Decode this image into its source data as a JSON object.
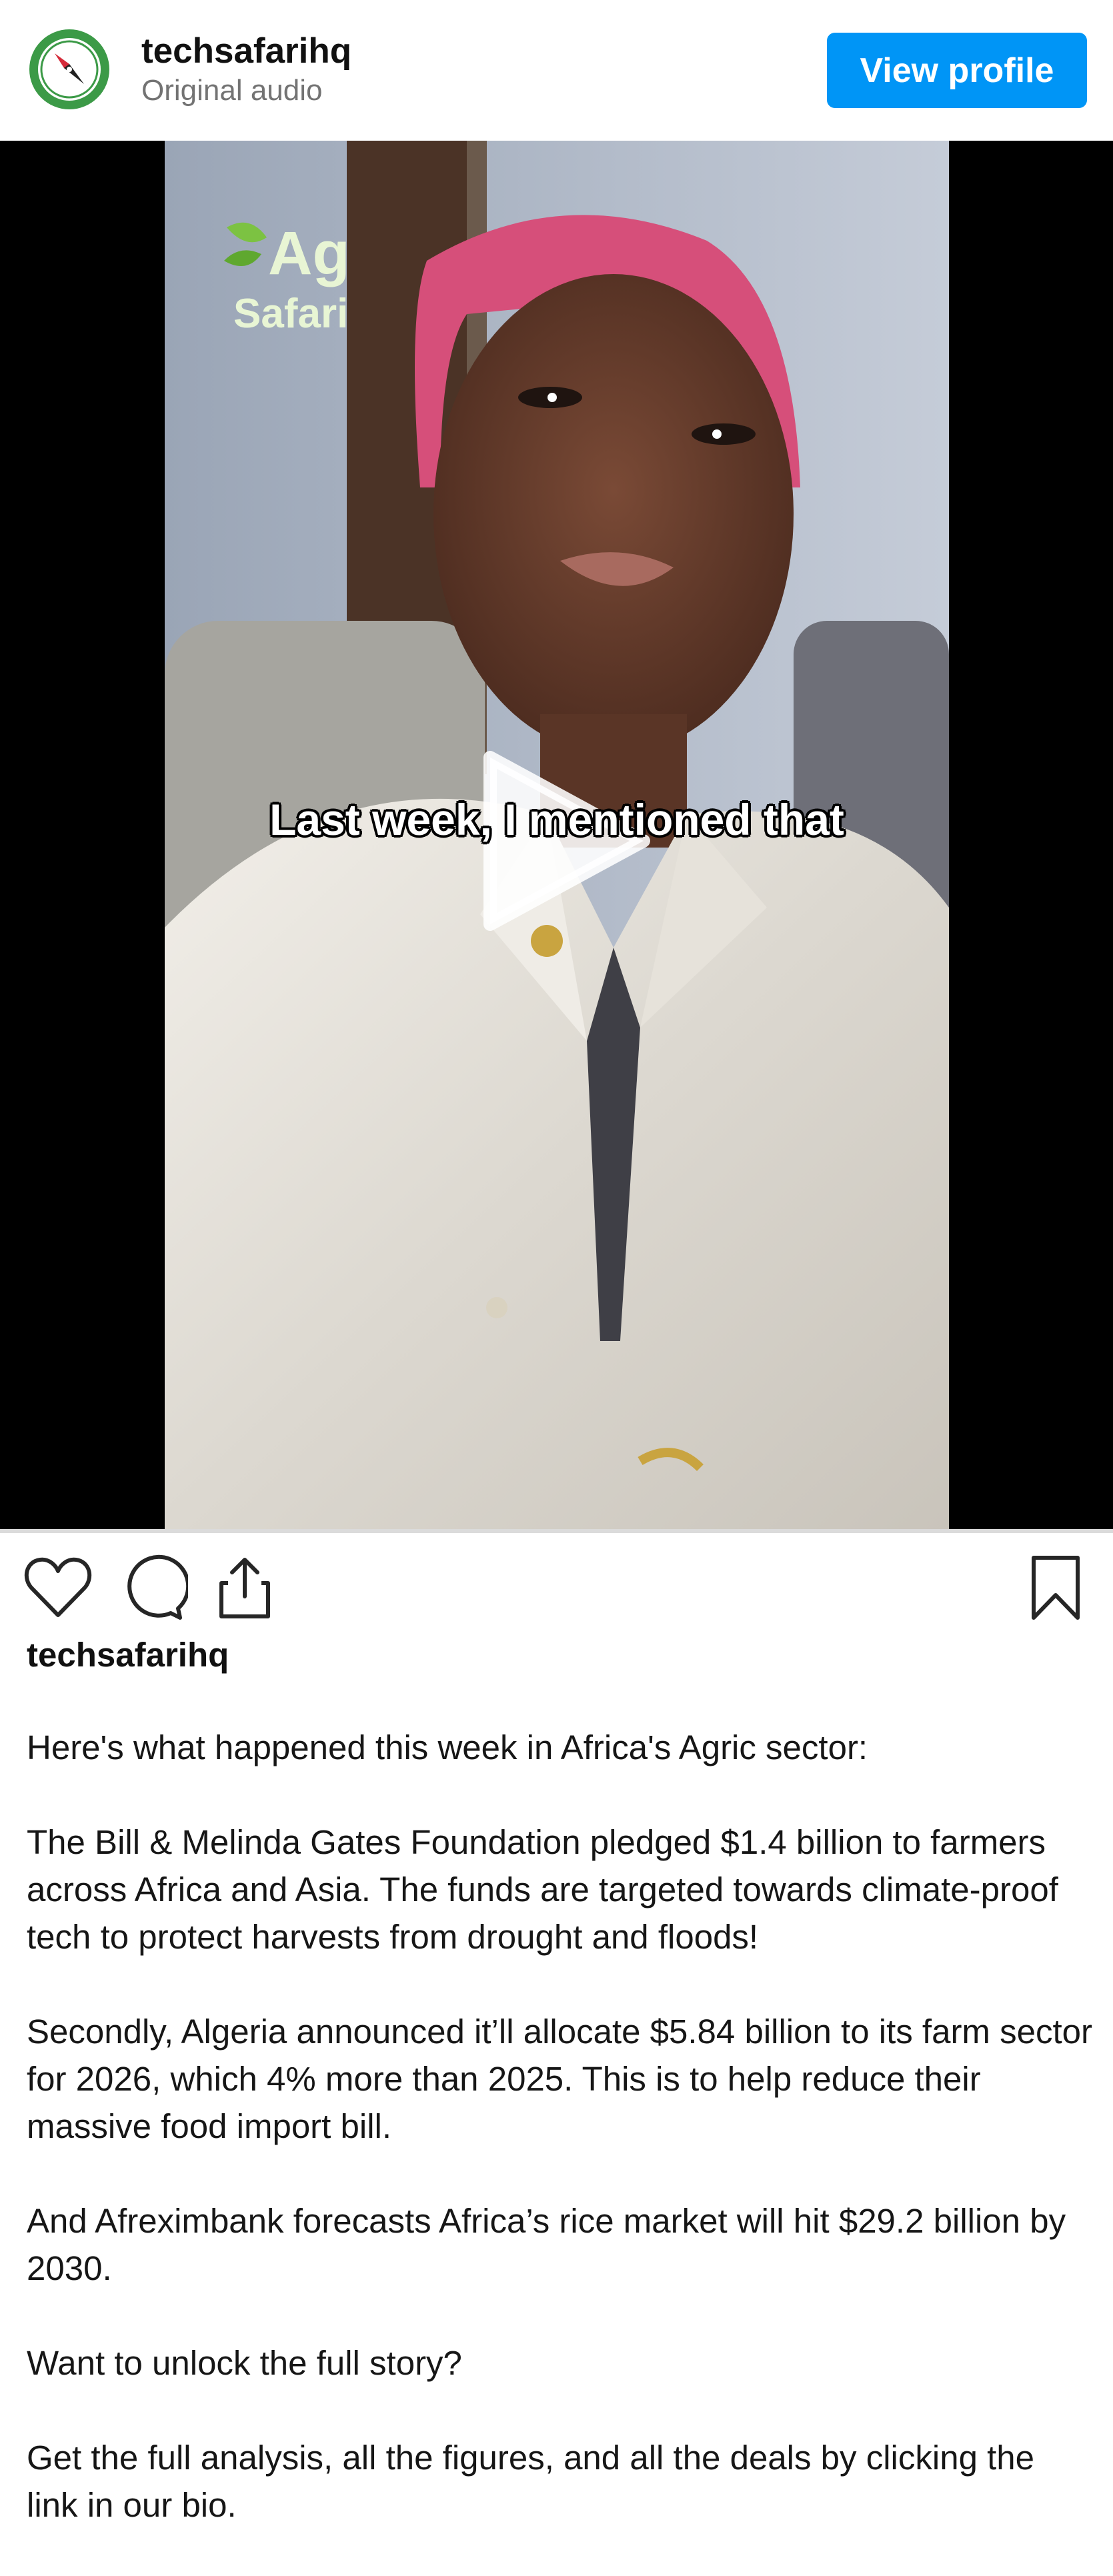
{
  "header": {
    "username": "techsafarihq",
    "subtitle": "Original audio",
    "view_profile_label": "View profile"
  },
  "video": {
    "caption": "Last week, I mentioned that",
    "logo_line1": "Ag",
    "logo_line2": "Safari",
    "play_icon": "play-icon",
    "progress_fraction": 0
  },
  "actions": {
    "icons": [
      "heart-icon",
      "comment-icon",
      "share-icon",
      "bookmark-icon"
    ]
  },
  "post": {
    "username": "techsafarihq",
    "paragraphs": [
      "Here's what happened this week in Africa's Agric sector:",
      "The Bill & Melinda Gates Foundation pledged $1.4 billion to farmers across Africa and Asia. The funds are targeted towards climate-proof tech to protect harvests from drought and floods!",
      "Secondly, Algeria announced it’ll allocate $5.84 billion to its farm sector for 2026, which 4% more than 2025. This is to help reduce their massive food import bill.",
      "And Afreximbank forecasts Africa’s rice market will hit $29.2 billion by 2030.",
      "Want to unlock the full story?",
      "Get the full analysis, all the figures, and all the deals by clicking the link in our bio."
    ]
  },
  "colors": {
    "accent": "#0095f6",
    "avatar_green": "#3c9a47",
    "logo_green": "#7cc242",
    "logo_text": "#e8f5d4"
  }
}
